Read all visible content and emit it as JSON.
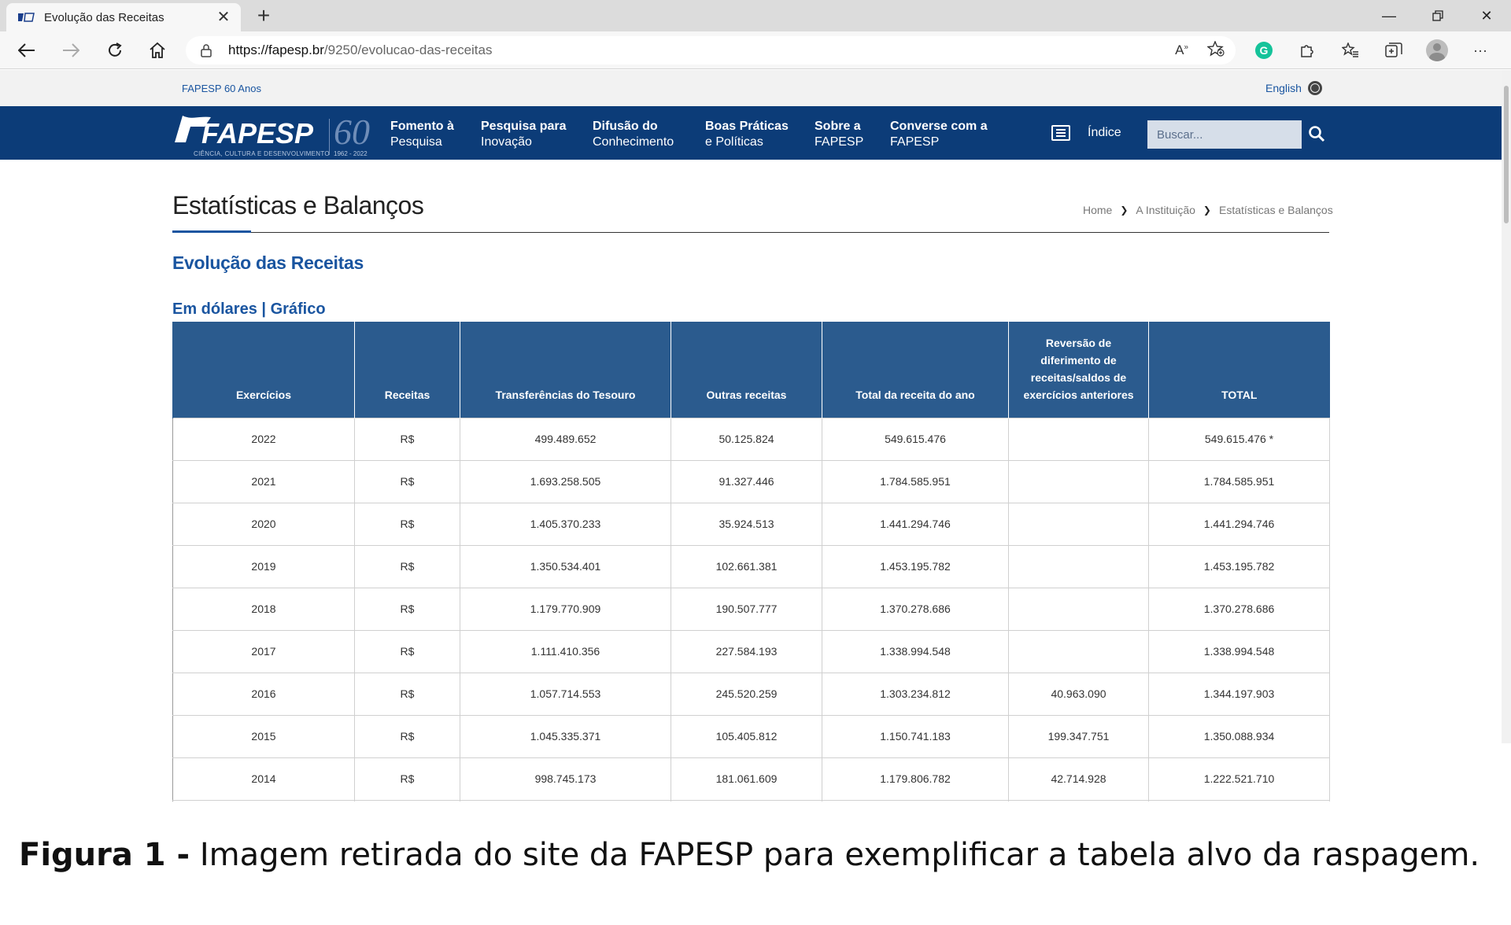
{
  "browser": {
    "tab_title": "Evolução das Receitas",
    "url_host": "https://fapesp.br",
    "url_path": "/9250/evolucao-das-receitas",
    "grammarly_letter": "G"
  },
  "site": {
    "fapesp60_link": "FAPESP 60 Anos",
    "language_link": "English",
    "logo_text": "FAPESP",
    "logo_tagline": "CIÊNCIA, CULTURA E DESENVOLVIMENTO",
    "logo_number": "60",
    "logo_years": "1962 - 2022",
    "menu": [
      {
        "line1": "Fomento à",
        "line2": "Pesquisa"
      },
      {
        "line1": "Pesquisa para",
        "line2": "Inovação"
      },
      {
        "line1": "Difusão do",
        "line2": "Conhecimento"
      },
      {
        "line1": "Boas Práticas",
        "line2": "e Políticas"
      },
      {
        "line1": "Sobre a",
        "line2": "FAPESP"
      },
      {
        "line1": "Converse com a",
        "line2": "FAPESP"
      }
    ],
    "index_label": "Índice",
    "search_placeholder": "Buscar..."
  },
  "content": {
    "page_title": "Estatísticas e Balanços",
    "breadcrumb": [
      "Home",
      "A Instituição",
      "Estatísticas e Balanços"
    ],
    "section_title": "Evolução das Receitas",
    "link_dollars": "Em dólares",
    "link_separator": "|",
    "link_chart": "Gráfico"
  },
  "table": {
    "headers": [
      "Exercícios",
      "Receitas",
      "Transferências do Tesouro",
      "Outras receitas",
      "Total da receita do ano",
      "Reversão de diferimento de receitas/saldos de exercícios anteriores",
      "TOTAL"
    ],
    "rows": [
      [
        "2022",
        "R$",
        "499.489.652",
        "50.125.824",
        "549.615.476",
        "",
        "549.615.476 *"
      ],
      [
        "2021",
        "R$",
        "1.693.258.505",
        "91.327.446",
        "1.784.585.951",
        "",
        "1.784.585.951"
      ],
      [
        "2020",
        "R$",
        "1.405.370.233",
        "35.924.513",
        "1.441.294.746",
        "",
        "1.441.294.746"
      ],
      [
        "2019",
        "R$",
        "1.350.534.401",
        "102.661.381",
        "1.453.195.782",
        "",
        "1.453.195.782"
      ],
      [
        "2018",
        "R$",
        "1.179.770.909",
        "190.507.777",
        "1.370.278.686",
        "",
        "1.370.278.686"
      ],
      [
        "2017",
        "R$",
        "1.111.410.356",
        "227.584.193",
        "1.338.994.548",
        "",
        "1.338.994.548"
      ],
      [
        "2016",
        "R$",
        "1.057.714.553",
        "245.520.259",
        "1.303.234.812",
        "40.963.090",
        "1.344.197.903"
      ],
      [
        "2015",
        "R$",
        "1.045.335.371",
        "105.405.812",
        "1.150.741.183",
        "199.347.751",
        "1.350.088.934"
      ],
      [
        "2014",
        "R$",
        "998.745.173",
        "181.061.609",
        "1.179.806.782",
        "42.714.928",
        "1.222.521.710"
      ]
    ]
  },
  "caption": {
    "bold": "Figura 1 -",
    "text": " Imagem retirada do site da FAPESP para exemplificar a tabela alvo da raspagem."
  }
}
